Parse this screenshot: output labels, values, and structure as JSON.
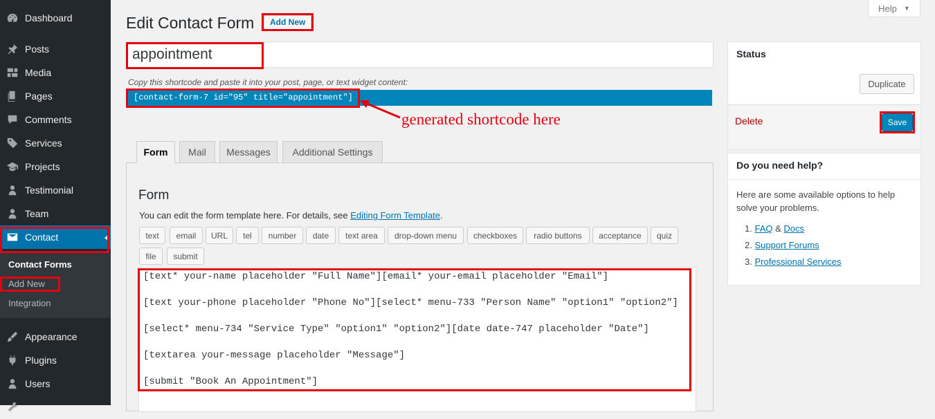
{
  "sidebar": {
    "items": [
      {
        "label": "Dashboard",
        "icon": "dashboard-icon"
      },
      {
        "label": "Posts",
        "icon": "pin-icon"
      },
      {
        "label": "Media",
        "icon": "media-icon"
      },
      {
        "label": "Pages",
        "icon": "pages-icon"
      },
      {
        "label": "Comments",
        "icon": "comment-icon"
      },
      {
        "label": "Services",
        "icon": "tag-icon"
      },
      {
        "label": "Projects",
        "icon": "portfolio-icon"
      },
      {
        "label": "Testimonial",
        "icon": "user-icon"
      },
      {
        "label": "Team",
        "icon": "user-icon"
      },
      {
        "label": "Contact",
        "icon": "mail-icon"
      },
      {
        "label": "Appearance",
        "icon": "brush-icon"
      },
      {
        "label": "Plugins",
        "icon": "plug-icon"
      },
      {
        "label": "Users",
        "icon": "user-icon"
      }
    ],
    "submenu": {
      "contact_forms": "Contact Forms",
      "add_new": "Add New",
      "integration": "Integration"
    }
  },
  "header": {
    "title": "Edit Contact Form",
    "add_new": "Add New",
    "help": "Help"
  },
  "form_title": "appointment",
  "shortcode": {
    "hint": "Copy this shortcode and paste it into your post, page, or text widget content:",
    "code": "[contact-form-7 id=\"95\" title=\"appointment\"]",
    "annotation": "generated shortcode here"
  },
  "tabs": [
    "Form",
    "Mail",
    "Messages",
    "Additional Settings"
  ],
  "form_panel": {
    "heading": "Form",
    "desc_prefix": "You can edit the form template here. For details, see ",
    "desc_link": "Editing Form Template",
    "desc_suffix": ".",
    "tag_buttons": [
      "text",
      "email",
      "URL",
      "tel",
      "number",
      "date",
      "text area",
      "drop-down menu",
      "checkboxes",
      "radio buttons",
      "acceptance",
      "quiz",
      "file",
      "submit"
    ],
    "template_lines": [
      "[text* your-name placeholder \"Full Name\"][email* your-email placeholder \"Email\"]",
      "[text your-phone placeholder \"Phone No\"][select* menu-733 \"Person Name\" \"option1\" \"option2\"]",
      "[select* menu-734 \"Service Type\" \"option1\" \"option2\"][date date-747 placeholder \"Date\"]",
      "[textarea your-message placeholder \"Message\"]",
      "[submit \"Book An Appointment\"]"
    ]
  },
  "status": {
    "title": "Status",
    "duplicate": "Duplicate",
    "delete": "Delete",
    "save": "Save"
  },
  "help_box": {
    "title": "Do you need help?",
    "text": "Here are some available options to help solve your problems.",
    "items": [
      {
        "num": "1.",
        "link1": "FAQ",
        "sep": " & ",
        "link2": "Docs"
      },
      {
        "num": "2.",
        "link1": "Support Forums"
      },
      {
        "num": "3.",
        "link1": "Professional Services"
      }
    ]
  },
  "colors": {
    "sidebar_bg": "#23282d",
    "active_bg": "#0073aa",
    "highlight": "#e3000f",
    "shortcode_bg": "#0085ba"
  }
}
